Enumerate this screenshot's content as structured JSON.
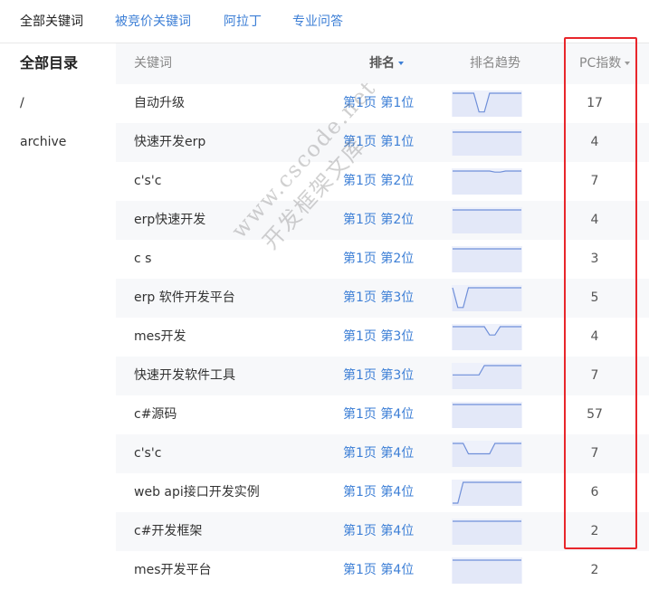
{
  "tabs": [
    {
      "label": "全部关键词",
      "active": true
    },
    {
      "label": "被竞价关键词",
      "active": false
    },
    {
      "label": "阿拉丁",
      "active": false
    },
    {
      "label": "专业问答",
      "active": false
    }
  ],
  "sidebar": {
    "title": "全部目录",
    "items": [
      "/",
      "archive"
    ]
  },
  "table": {
    "headers": {
      "keyword": "关键词",
      "rank": "排名",
      "trend": "排名趋势",
      "pc_index": "PC指数"
    },
    "rows": [
      {
        "keyword": "自动升级",
        "rank": "第1页 第1位",
        "pc_index": "17",
        "trend": [
          0,
          0,
          0,
          0,
          0,
          0.9,
          0.9,
          0,
          0,
          0,
          0,
          0,
          0,
          0
        ]
      },
      {
        "keyword": "快速开发erp",
        "rank": "第1页 第1位",
        "pc_index": "4",
        "trend": [
          0,
          0,
          0,
          0,
          0,
          0,
          0,
          0,
          0,
          0,
          0,
          0,
          0,
          0
        ]
      },
      {
        "keyword": "c's'c",
        "rank": "第1页 第2位",
        "pc_index": "7",
        "trend": [
          0,
          0,
          0,
          0,
          0,
          0,
          0,
          0,
          0.05,
          0.05,
          0,
          0,
          0,
          0
        ]
      },
      {
        "keyword": "erp快速开发",
        "rank": "第1页 第2位",
        "pc_index": "4",
        "trend": [
          0,
          0,
          0,
          0,
          0,
          0,
          0,
          0,
          0,
          0,
          0,
          0,
          0,
          0
        ]
      },
      {
        "keyword": "c s",
        "rank": "第1页 第2位",
        "pc_index": "3",
        "trend": [
          0,
          0,
          0,
          0,
          0,
          0,
          0,
          0,
          0,
          0,
          0,
          0,
          0,
          0
        ]
      },
      {
        "keyword": "erp 软件开发平台",
        "rank": "第1页 第3位",
        "pc_index": "5",
        "trend": [
          0,
          0.95,
          0.95,
          0,
          0,
          0,
          0,
          0,
          0,
          0,
          0,
          0,
          0,
          0
        ]
      },
      {
        "keyword": "mes开发",
        "rank": "第1页 第3位",
        "pc_index": "4",
        "trend": [
          0,
          0,
          0,
          0,
          0,
          0,
          0,
          0.4,
          0.4,
          0,
          0,
          0,
          0,
          0
        ]
      },
      {
        "keyword": "快速开发软件工具",
        "rank": "第1页 第3位",
        "pc_index": "7",
        "trend": [
          0.45,
          0.45,
          0.45,
          0.45,
          0.45,
          0.45,
          0,
          0,
          0,
          0,
          0,
          0,
          0,
          0
        ]
      },
      {
        "keyword": "c#源码",
        "rank": "第1页 第4位",
        "pc_index": "57",
        "trend": [
          0,
          0,
          0,
          0,
          0,
          0,
          0,
          0,
          0,
          0,
          0,
          0,
          0,
          0
        ]
      },
      {
        "keyword": "c's'c",
        "rank": "第1页 第4位",
        "pc_index": "7",
        "trend": [
          0,
          0,
          0,
          0.5,
          0.5,
          0.5,
          0.5,
          0.5,
          0,
          0,
          0,
          0,
          0,
          0
        ]
      },
      {
        "keyword": "web api接口开发实例",
        "rank": "第1页 第4位",
        "pc_index": "6",
        "trend": [
          1,
          1,
          0,
          0,
          0,
          0,
          0,
          0,
          0,
          0,
          0,
          0,
          0,
          0
        ]
      },
      {
        "keyword": "c#开发框架",
        "rank": "第1页 第4位",
        "pc_index": "2",
        "trend": [
          0,
          0,
          0,
          0,
          0,
          0,
          0,
          0,
          0,
          0,
          0,
          0,
          0,
          0
        ]
      },
      {
        "keyword": "mes开发平台",
        "rank": "第1页 第4位",
        "pc_index": "2",
        "trend": [
          0,
          0,
          0,
          0,
          0,
          0,
          0,
          0,
          0,
          0,
          0,
          0,
          0,
          0
        ]
      }
    ]
  },
  "watermark": {
    "line1": "www.cscode.net",
    "line2": "开发框架文库"
  },
  "colors": {
    "link": "#3d7fd6",
    "highlight_border": "#e8262b",
    "row_alt": "#f7f8fa",
    "trend_line": "#6f8fd9",
    "trend_fill": "#eef1fb"
  }
}
